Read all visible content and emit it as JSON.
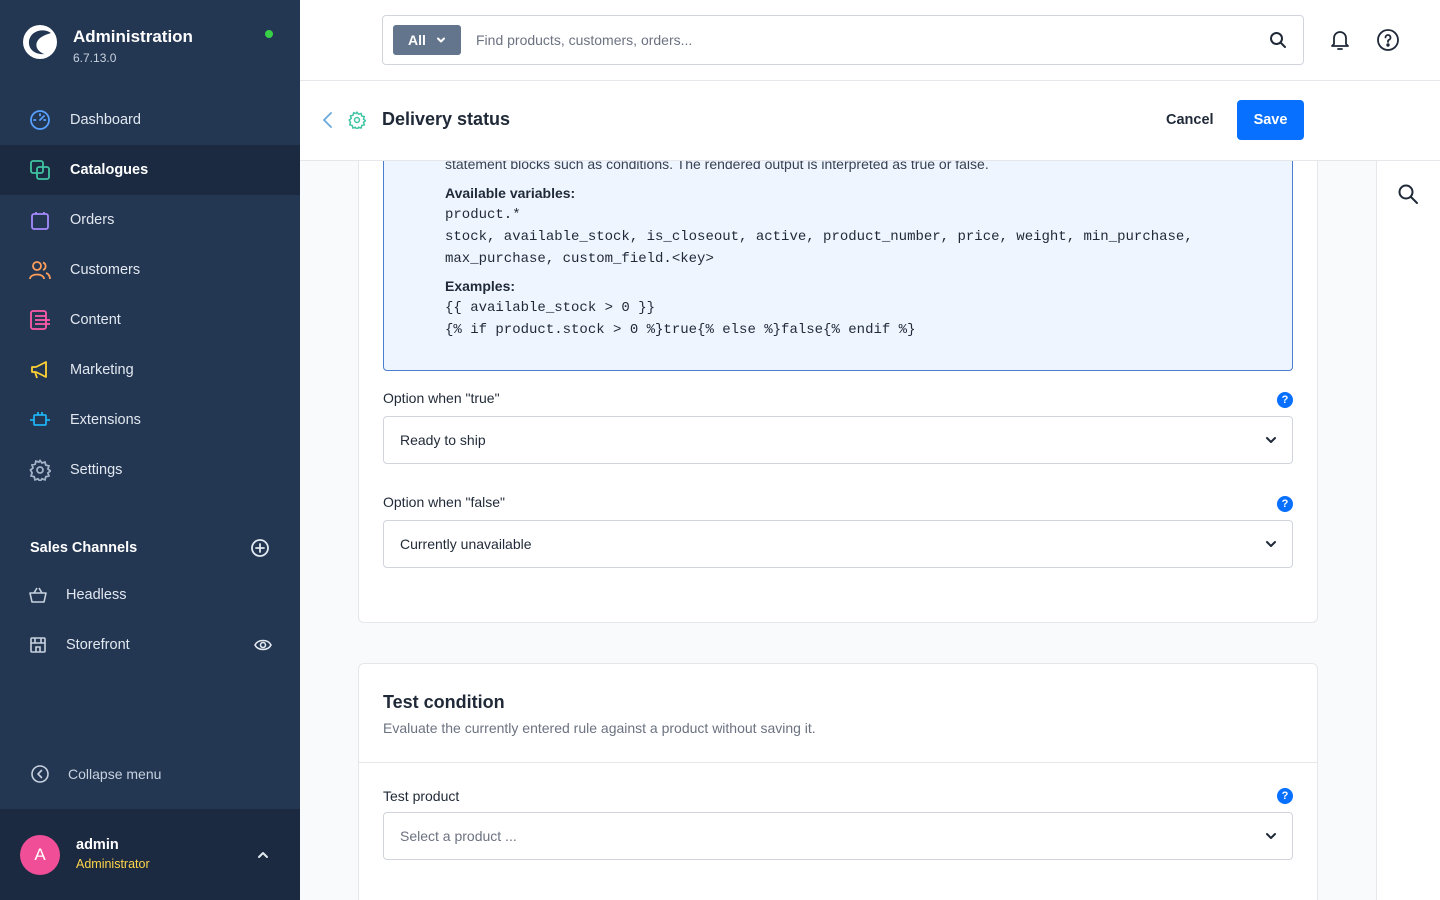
{
  "app": {
    "title": "Administration",
    "version": "6.7.13.0"
  },
  "sidebar": {
    "items": [
      {
        "label": "Dashboard",
        "icon": "dashboard-icon",
        "color": "#57a0ff",
        "active": false
      },
      {
        "label": "Catalogues",
        "icon": "catalogue-icon",
        "color": "#3fc4a2",
        "active": true
      },
      {
        "label": "Orders",
        "icon": "orders-icon",
        "color": "#a68bff",
        "active": false
      },
      {
        "label": "Customers",
        "icon": "customers-icon",
        "color": "#ff9e5b",
        "active": false
      },
      {
        "label": "Content",
        "icon": "content-icon",
        "color": "#ff5aa9",
        "active": false
      },
      {
        "label": "Marketing",
        "icon": "marketing-icon",
        "color": "#ffd234",
        "active": false
      },
      {
        "label": "Extensions",
        "icon": "extensions-icon",
        "color": "#1fb3f2",
        "active": false
      },
      {
        "label": "Settings",
        "icon": "settings-icon",
        "color": "#a3b3c7",
        "active": false
      }
    ],
    "sales_channels": {
      "title": "Sales Channels",
      "items": [
        {
          "label": "Headless",
          "icon": "basket-icon"
        },
        {
          "label": "Storefront",
          "icon": "storefront-icon"
        }
      ]
    },
    "collapse_label": "Collapse menu",
    "user": {
      "initial": "A",
      "name": "admin",
      "role": "Administrator"
    }
  },
  "topbar": {
    "search_type": "All",
    "search_placeholder": "Find products, customers, orders..."
  },
  "page": {
    "title": "Delivery status",
    "cancel_label": "Cancel",
    "save_label": "Save"
  },
  "help": {
    "intro": "statement blocks such as conditions. The rendered output is interpreted as true or false.",
    "variables_heading": "Available variables:",
    "variables_lines": [
      "product.*",
      "stock, available_stock, is_closeout, active, product_number, price, weight, min_purchase,",
      "max_purchase, custom_field.<key>"
    ],
    "examples_heading": "Examples:",
    "examples_lines": [
      "{{ available_stock > 0 }}",
      "{% if product.stock > 0 %}true{% else %}false{% endif %}"
    ]
  },
  "fields": {
    "true_label": "Option when \"true\"",
    "true_value": "Ready to ship",
    "false_label": "Option when \"false\"",
    "false_value": "Currently unavailable"
  },
  "test": {
    "title": "Test condition",
    "subtitle": "Evaluate the currently entered rule against a product without saving it.",
    "product_label": "Test product",
    "product_placeholder": "Select a product ..."
  },
  "colors": {
    "sidebar_bg": "#233652",
    "accent": "#0870ff",
    "online": "#37d046",
    "avatar": "#f04f98",
    "role": "#ffd54a"
  }
}
